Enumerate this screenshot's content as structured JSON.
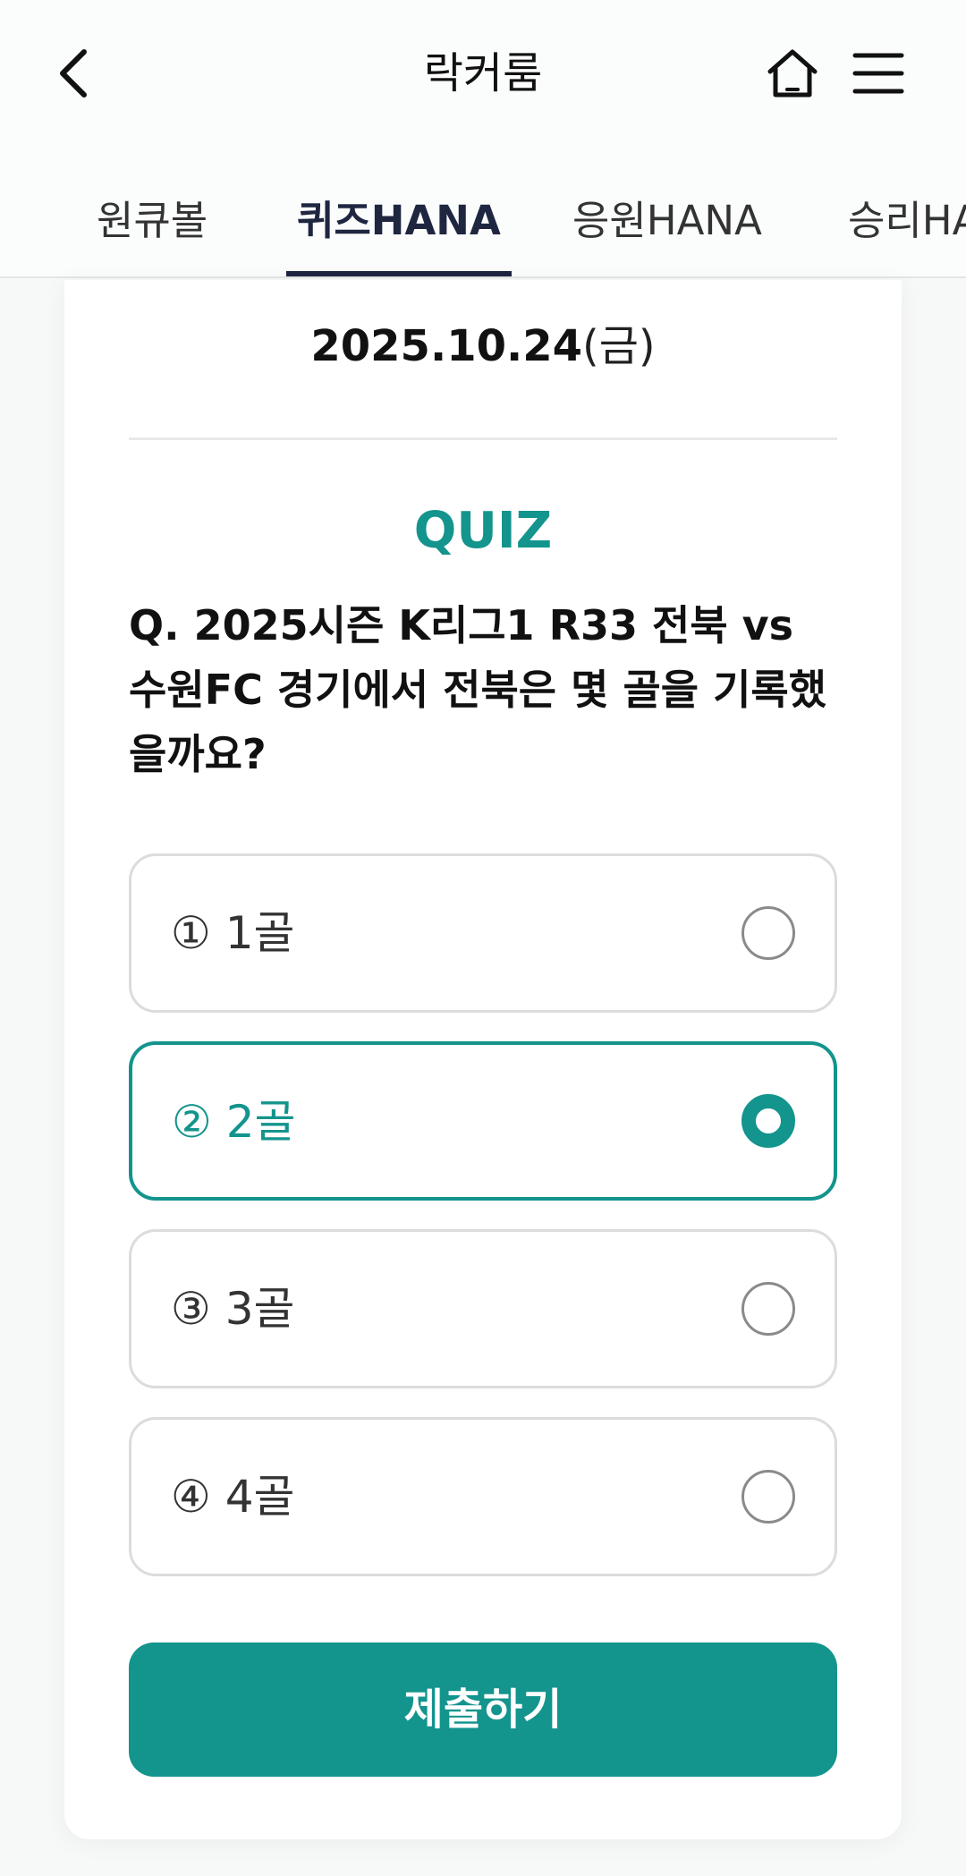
{
  "header": {
    "title": "락커룸",
    "back_icon": "chevron-left-icon",
    "home_icon": "home-icon",
    "menu_icon": "hamburger-menu-icon"
  },
  "tabs": [
    {
      "label": "원큐볼",
      "active": false
    },
    {
      "label": "퀴즈HANA",
      "active": true
    },
    {
      "label": "응원HANA",
      "active": false
    },
    {
      "label": "승리HANA",
      "active": false
    }
  ],
  "quiz": {
    "date": "2025.10.24",
    "weekday": "(금)",
    "label": "QUIZ",
    "question": "Q. 2025시즌 K리그1 R33 전북 vs 수원FC 경기에서 전북은 몇 골을 기록했을까요?",
    "options": [
      {
        "label": "① 1골",
        "selected": false
      },
      {
        "label": "② 2골",
        "selected": true
      },
      {
        "label": "③ 3골",
        "selected": false
      },
      {
        "label": "④ 4골",
        "selected": false
      }
    ],
    "submit_label": "제출하기"
  },
  "colors": {
    "accent": "#13948d",
    "tab_indicator": "#1e2540",
    "border": "#dcdcdc"
  }
}
